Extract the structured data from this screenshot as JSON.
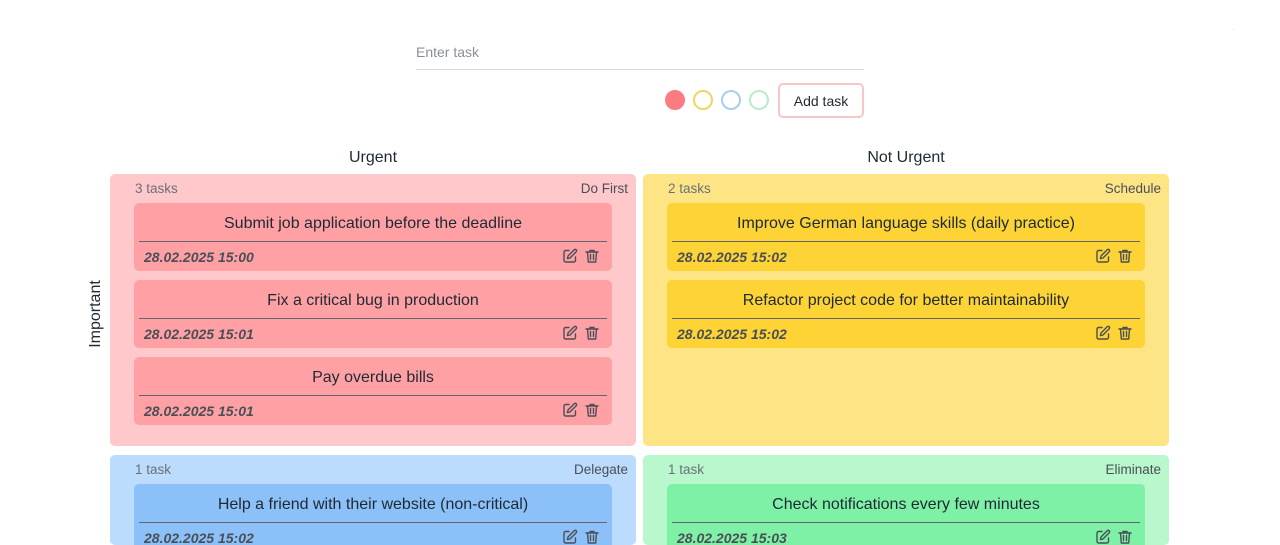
{
  "input": {
    "placeholder": "Enter task",
    "value": ""
  },
  "color_picker": [
    {
      "name": "red",
      "fill": "#fb7c80",
      "border": "#fb7c80",
      "selected": true
    },
    {
      "name": "yellow",
      "fill": "#ffffff",
      "border": "#f2d463",
      "selected": false
    },
    {
      "name": "blue",
      "fill": "#ffffff",
      "border": "#a9cdee",
      "selected": false
    },
    {
      "name": "green",
      "fill": "#ffffff",
      "border": "#b6ecc9",
      "selected": false
    }
  ],
  "add_button": {
    "label": "Add task"
  },
  "headers": {
    "urgent": "Urgent",
    "not_urgent": "Not Urgent",
    "important": "Important"
  },
  "quadrants": [
    {
      "id": "do-first",
      "label": "Do First",
      "count": "3 tasks",
      "bg": "#ffc9cb",
      "card": "#ffa1a4",
      "tasks": [
        {
          "title": "Submit job application before the deadline",
          "date": "28.02.2025 15:00"
        },
        {
          "title": "Fix a critical bug in production",
          "date": "28.02.2025 15:01"
        },
        {
          "title": "Pay overdue bills",
          "date": "28.02.2025 15:01"
        }
      ]
    },
    {
      "id": "schedule",
      "label": "Schedule",
      "count": "2 tasks",
      "bg": "#fde586",
      "card": "#fdd335",
      "tasks": [
        {
          "title": "Improve German language skills (daily practice)",
          "date": "28.02.2025 15:02"
        },
        {
          "title": "Refactor project code for better maintainability",
          "date": "28.02.2025 15:02"
        }
      ]
    },
    {
      "id": "delegate",
      "label": "Delegate",
      "count": "1 task",
      "bg": "#bcdcfd",
      "card": "#8cc0f9",
      "tasks": [
        {
          "title": "Help a friend with their website (non-critical)",
          "date": "28.02.2025 15:02"
        }
      ]
    },
    {
      "id": "eliminate",
      "label": "Eliminate",
      "count": "1 task",
      "bg": "#b9f7cd",
      "card": "#7ef1a7",
      "tasks": [
        {
          "title": "Check notifications every few minutes",
          "date": "28.02.2025 15:03"
        }
      ]
    }
  ],
  "icons": {
    "theme": "moon-icon",
    "edit": "edit-icon",
    "delete": "trash-icon"
  },
  "accent": "#7b17d6"
}
